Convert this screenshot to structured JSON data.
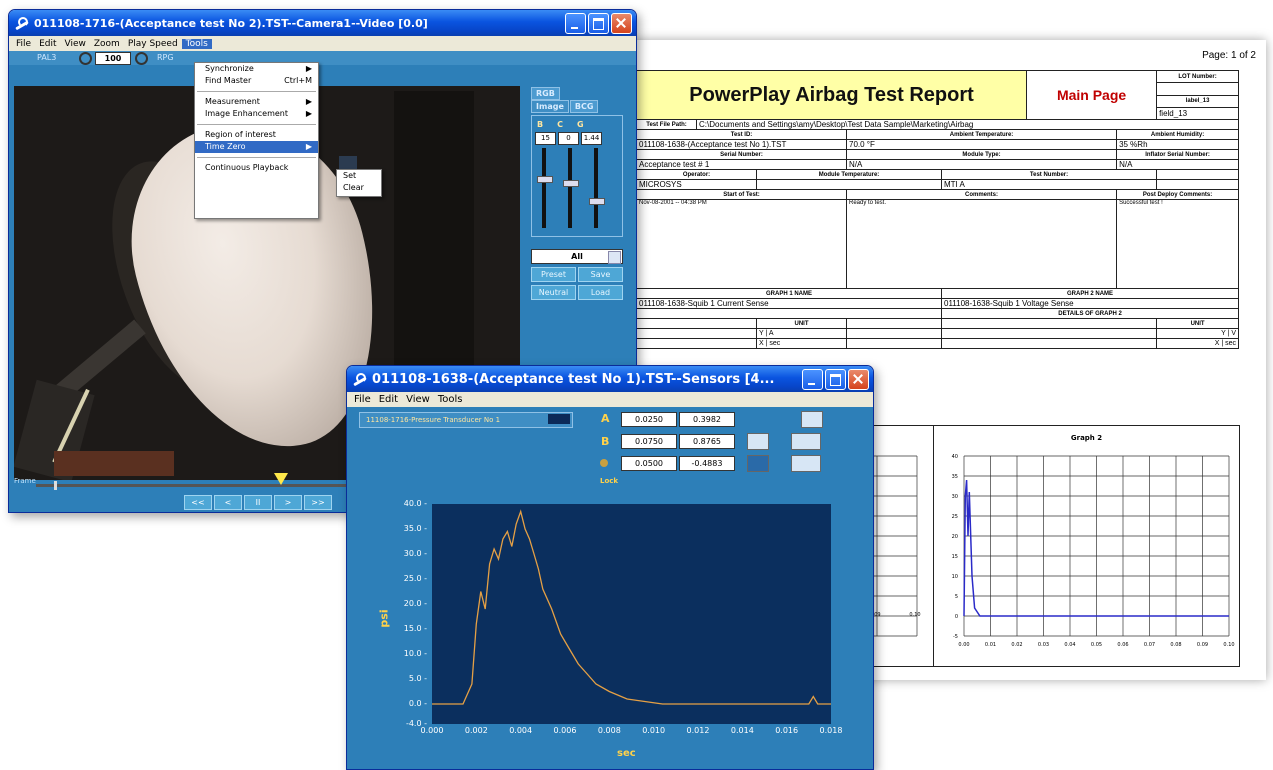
{
  "video_window": {
    "title": "011108-1716-(Acceptance test No 2).TST--Camera1--Video [0.0]",
    "menu": [
      "File",
      "Edit",
      "View",
      "Zoom",
      "Play Speed",
      "Tools"
    ],
    "toolbar": {
      "left_label": "PAL3",
      "zoom_value": "100",
      "right_label": "RPG"
    },
    "tools_menu": [
      {
        "label": "Synchronize",
        "shortcut": "▶"
      },
      {
        "label": "Find Master",
        "shortcut": "Ctrl+M"
      },
      {
        "label": "Measurement",
        "shortcut": "▶"
      },
      {
        "label": "Image Enhancement",
        "shortcut": "▶"
      },
      {
        "label": "Region of interest",
        "shortcut": ""
      },
      {
        "label": "Time Zero",
        "shortcut": "▶"
      },
      {
        "label": "Continuous Playback",
        "shortcut": ""
      }
    ],
    "time_zero_submenu": [
      "Set",
      "Clear"
    ],
    "side_tabs": [
      "RGB",
      "Image",
      "BCG"
    ],
    "rgb_header": [
      "B",
      "C",
      "G"
    ],
    "rgb_values": [
      "15",
      "0",
      "1.44"
    ],
    "channel_select": "All",
    "buttons": [
      "Preset",
      "Save",
      "Neutral",
      "Load"
    ],
    "frame_label": "Frame",
    "transport": [
      "<<",
      "<",
      "II",
      ">",
      ">>"
    ]
  },
  "report": {
    "page": "Page: 1 of 2",
    "title": "PowerPlay Airbag Test Report",
    "main_page": "Main Page",
    "lot_label": "LOT Number:",
    "label_field": "label_13",
    "field_value": "field_13",
    "test_file_path_label": "Test File Path:",
    "test_file_path": "C:\\Documents and Settings\\amy\\Desktop\\Test Data Sample\\Marketing\\Airbag",
    "headers1": [
      "Test ID:",
      "Ambient Temperature:",
      "Ambient Humidity:"
    ],
    "values1": [
      "011108-1638-(Acceptance test No 1).TST",
      "70.0 °F",
      "35 %Rh"
    ],
    "headers2": [
      "Serial Number:",
      "Module Type:",
      "Inflator Serial Number:"
    ],
    "values2": [
      "Acceptance test # 1",
      "N/A",
      "N/A"
    ],
    "headers3": [
      "Operator:",
      "Module Temperature:",
      "Test Number:"
    ],
    "values3": [
      "MICROSYS",
      "",
      "MTI A"
    ],
    "headers4": [
      "Start of Test:",
      "Comments:",
      "Post Deploy Comments:"
    ],
    "values4": [
      "Nov-08-2001 -- 04:38 PM",
      "Ready to test.",
      "Successful test !"
    ],
    "graph1_name_label": "GRAPH 1 NAME",
    "graph2_name_label": "GRAPH 2 NAME",
    "graph1_name": "011108-1638-Squib 1 Current Sense",
    "graph2_name": "011108-1638-Squib 1 Voltage Sense",
    "details2": "DETAILS OF GRAPH 2",
    "unit_label": "UNIT",
    "units1": [
      "A",
      "sec"
    ],
    "units2": [
      "V",
      "sec"
    ],
    "axes": [
      "Y",
      "X"
    ],
    "graph2_title": "Graph 2",
    "g2_yticks": [
      "40",
      "35",
      "30",
      "25",
      "20",
      "15",
      "10",
      "5",
      "0",
      "-5"
    ],
    "g2_xticks": [
      "0.00",
      "0.01",
      "0.02",
      "0.03",
      "0.04",
      "0.05",
      "0.06",
      "0.07",
      "0.08",
      "0.09",
      "0.10"
    ],
    "g1_xticks": [
      "0.09",
      "0.10"
    ]
  },
  "sensors_window": {
    "title": "011108-1638-(Acceptance test No 1).TST--Sensors [4...",
    "menu": [
      "File",
      "Edit",
      "View",
      "Tools"
    ],
    "channel": "11108-1716-Pressure Transducer No 1",
    "cursor_labels": [
      "A",
      "B"
    ],
    "cursor_values": [
      [
        "0.0250",
        "0.3982"
      ],
      [
        "0.0750",
        "0.8765"
      ],
      [
        "0.0500",
        "-0.4883"
      ]
    ],
    "lock_label": "Lock",
    "chart_data": {
      "type": "line",
      "title": "",
      "xlabel": "sec",
      "ylabel": "psi",
      "xlim": [
        0,
        0.018
      ],
      "ylim": [
        -4.0,
        40.0
      ],
      "yticks": [
        "40.0",
        "35.0",
        "30.0",
        "25.0",
        "20.0",
        "15.0",
        "10.0",
        "5.0",
        "0.0",
        "-4.0"
      ],
      "xticks": [
        "0.000",
        "0.002",
        "0.004",
        "0.006",
        "0.008",
        "0.010",
        "0.012",
        "0.014",
        "0.016",
        "0.018"
      ],
      "series": [
        {
          "color": "#e5a045",
          "x": [
            0.0,
            0.0014,
            0.0018,
            0.002,
            0.0022,
            0.0024,
            0.0026,
            0.0028,
            0.003,
            0.0032,
            0.0034,
            0.0036,
            0.0038,
            0.004,
            0.0042,
            0.0044,
            0.0046,
            0.0048,
            0.005,
            0.0054,
            0.0058,
            0.0062,
            0.0066,
            0.007,
            0.0074,
            0.008,
            0.0088,
            0.0096,
            0.0104,
            0.012,
            0.014,
            0.016,
            0.017,
            0.0172,
            0.0174,
            0.018
          ],
          "y": [
            0.0,
            0.0,
            4.0,
            16.0,
            22.5,
            19.0,
            28.0,
            31.0,
            29.0,
            33.0,
            34.5,
            31.5,
            36.0,
            38.5,
            35.0,
            33.0,
            30.0,
            27.0,
            23.0,
            19.0,
            14.0,
            11.0,
            8.0,
            6.0,
            4.0,
            2.5,
            1.0,
            0.5,
            0.0,
            0.0,
            0.0,
            0.0,
            0.0,
            1.5,
            0.0,
            0.0
          ]
        }
      ]
    }
  }
}
